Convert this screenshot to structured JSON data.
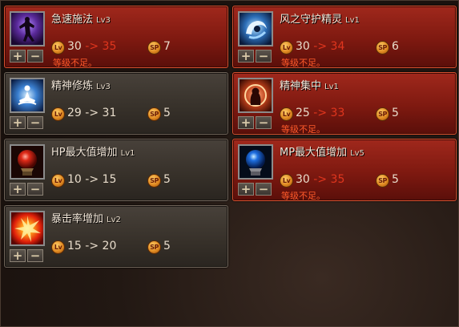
{
  "skills": [
    {
      "id": "haste",
      "name": "急速施法",
      "level": "Lv3",
      "lv_from": "30",
      "arrow": "->",
      "lv_to": "35",
      "sp": "7",
      "warn": "等级不足。",
      "icon": "shadow-figure-icon"
    },
    {
      "id": "wind",
      "name": "风之守护精灵",
      "level": "Lv1",
      "lv_from": "30",
      "arrow": "->",
      "lv_to": "34",
      "sp": "6",
      "warn": "等级不足。",
      "icon": "wind-spirit-helmet-icon"
    },
    {
      "id": "meditate",
      "name": "精神修炼",
      "level": "Lv3",
      "lv_from": "29",
      "arrow": "->",
      "lv_to": "31",
      "sp": "5",
      "icon": "meditation-icon"
    },
    {
      "id": "focus",
      "name": "精神集中",
      "level": "Lv1",
      "lv_from": "25",
      "arrow": "->",
      "lv_to": "33",
      "sp": "5",
      "warn": "等级不足。",
      "icon": "mind-focus-icon"
    },
    {
      "id": "hp",
      "name": "HP最大值增加",
      "level": "Lv1",
      "lv_from": "10",
      "arrow": "->",
      "lv_to": "15",
      "sp": "5",
      "icon": "red-orb-icon"
    },
    {
      "id": "mp",
      "name": "MP最大值增加",
      "level": "Lv5",
      "lv_from": "30",
      "arrow": "->",
      "lv_to": "35",
      "sp": "5",
      "warn": "等级不足。",
      "icon": "blue-orb-icon"
    },
    {
      "id": "crit",
      "name": "暴击率增加",
      "level": "Lv2",
      "lv_from": "15",
      "arrow": "->",
      "lv_to": "20",
      "sp": "5",
      "icon": "critical-burst-icon"
    }
  ],
  "labels": {
    "lv_badge": "Lv",
    "sp_badge": "SP",
    "plus": "+",
    "minus": "−"
  },
  "colors": {
    "locked_card": "#8a1e14",
    "available_card": "#3c362f",
    "warn_text": "#ff5a2a"
  }
}
